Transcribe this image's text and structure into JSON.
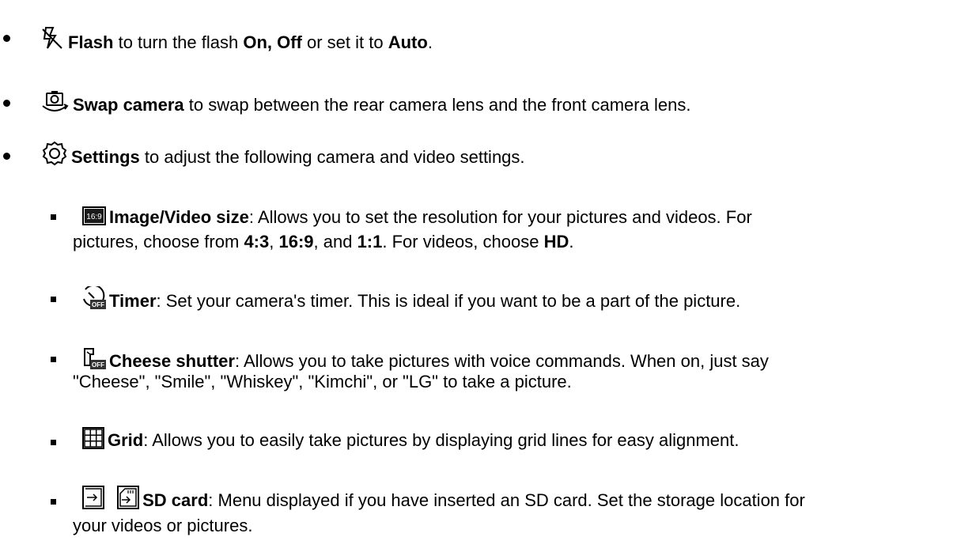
{
  "items": [
    {
      "icon": "flash-off-icon",
      "bold": "Flash",
      "t1": " to turn the flash ",
      "b2": "On, Off",
      "t2": " or set it to ",
      "b3": "Auto",
      "t3": "."
    },
    {
      "icon": "swap-camera-icon",
      "bold": "Swap camera",
      "t1": " to swap between the rear camera lens and the front camera lens."
    },
    {
      "icon": "settings-gear-icon",
      "bold": "Settings",
      "t1": " to adjust the following camera and video settings."
    }
  ],
  "subitems": [
    {
      "icon": "image-size-16-9-icon",
      "icon_text": "16:9",
      "bold": "Image/Video size",
      "line1": ": Allows you to set the resolution for your pictures and videos. For",
      "l2a": "pictures, choose from ",
      "l2b": "4:3",
      "l2c": ", ",
      "l2d": "16:9",
      "l2e": ", and ",
      "l2f": "1:1",
      "l2g": ". For videos, choose ",
      "l2h": "HD",
      "l2i": "."
    },
    {
      "icon": "timer-off-icon",
      "icon_text": "OFF",
      "bold": "Timer",
      "line1": ": Set your camera's timer. This is ideal if you want to be a part of the picture."
    },
    {
      "icon": "cheese-shutter-off-icon",
      "icon_text": "OFF",
      "bold": "Cheese shutter",
      "line1": ": Allows you to take pictures with voice commands. When on, just say",
      "line2": "\"Cheese\", \"Smile\", \"Whiskey\", \"Kimchi\", or \"LG\" to take a picture."
    },
    {
      "icon": "grid-icon",
      "bold": "Grid",
      "line1": ": Allows you to easily take pictures by displaying grid lines for easy alignment."
    },
    {
      "icon": "sd-card-icon",
      "bold": "SD card",
      "line1": ": Menu displayed if you have inserted an SD card. Set the storage location for",
      "line2": "your videos or pictures."
    }
  ]
}
